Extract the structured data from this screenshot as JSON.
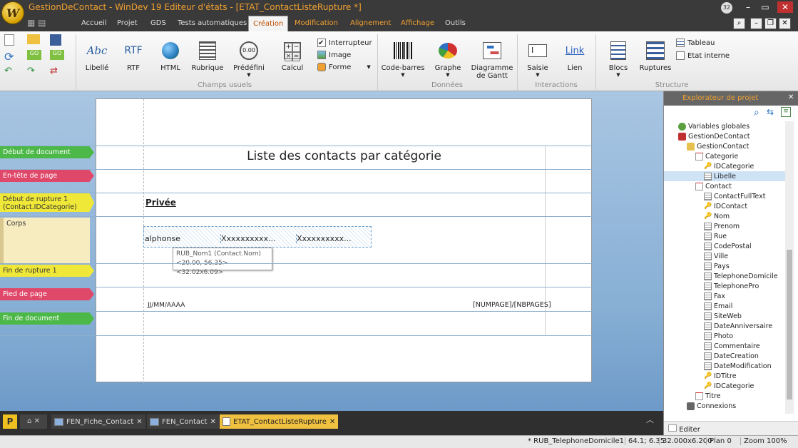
{
  "app": {
    "title": "GestionDeContact - WinDev 19  Editeur d'états - [ETAT_ContactListeRupture *]",
    "logo": "W",
    "notif_count": "32"
  },
  "menu": {
    "tabs": [
      "Accueil",
      "Projet",
      "GDS",
      "Tests automatiques",
      "Création",
      "Modification",
      "Alignement",
      "Affichage",
      "Outils"
    ]
  },
  "ribbon": {
    "champs": [
      {
        "label": "Libellé",
        "icon": "Abc"
      },
      {
        "label": "RTF",
        "icon": "RTF"
      },
      {
        "label": "HTML",
        "icon": "html-globe-icon"
      },
      {
        "label": "Rubrique",
        "icon": "rubrique-icon"
      },
      {
        "label": "Prédéfini",
        "icon": "predefini-icon"
      },
      {
        "label": "Calcul",
        "icon": "calc-icon"
      }
    ],
    "champs_small": [
      "Interrupteur",
      "Image",
      "Forme"
    ],
    "donnees": [
      {
        "label": "Code-barres"
      },
      {
        "label": "Graphe"
      },
      {
        "label": "Diagramme de Gantt"
      }
    ],
    "interactions": [
      {
        "label": "Saisie"
      },
      {
        "label": "Lien",
        "icon": "Link"
      }
    ],
    "structure": [
      {
        "label": "Blocs"
      },
      {
        "label": "Ruptures"
      }
    ],
    "structure_small": [
      "Tableau",
      "Etat interne"
    ],
    "groups": [
      "Champs usuels",
      "Données",
      "Interactions",
      "Structure"
    ]
  },
  "report": {
    "bands": [
      {
        "label": "Début de document",
        "color": "#4cb848"
      },
      {
        "label": "En-tête de page",
        "color": "#e0486a"
      },
      {
        "label": "Début de rupture 1",
        "label2": "(Contact.IDCategorie)",
        "color": "#f0e838"
      },
      {
        "label": "Corps",
        "color": "#f7ecc0"
      },
      {
        "label": "Fin de rupture 1",
        "color": "#f0e838"
      },
      {
        "label": "Pied de page",
        "color": "#e0486a"
      },
      {
        "label": "Fin de document",
        "color": "#4cb848"
      }
    ],
    "title": "Liste des contacts par catégorie",
    "rupture_text": "Privée",
    "body_fields": [
      "alphonse",
      "Xxxxxxxxxx...",
      "Xxxxxxxxxx..."
    ],
    "tooltip": {
      "line1": "RUB_Nom1 (Contact.Nom)",
      "line2": "<20.00, 56.35> <32.02x6.09>"
    },
    "date_field": "JJ/MM/AAAA",
    "pages_field": "[NUMPAGE]/[NBPAGES]"
  },
  "explorer": {
    "title": "Explorateur de projet",
    "items": [
      {
        "label": "Variables globales",
        "level": 1,
        "icon": "globe"
      },
      {
        "label": "GestionDeContact",
        "level": 1,
        "icon": "db"
      },
      {
        "label": "GestionContact",
        "level": 2,
        "icon": "folder"
      },
      {
        "label": "Categorie",
        "level": 3,
        "icon": "table"
      },
      {
        "label": "IDCategorie",
        "level": 4,
        "icon": "key"
      },
      {
        "label": "Libelle",
        "level": 4,
        "icon": "field",
        "selected": true
      },
      {
        "label": "Contact",
        "level": 3,
        "icon": "table"
      },
      {
        "label": "ContactFullText",
        "level": 4,
        "icon": "field"
      },
      {
        "label": "IDContact",
        "level": 4,
        "icon": "key"
      },
      {
        "label": "Nom",
        "level": 4,
        "icon": "key"
      },
      {
        "label": "Prenom",
        "level": 4,
        "icon": "field"
      },
      {
        "label": "Rue",
        "level": 4,
        "icon": "field"
      },
      {
        "label": "CodePostal",
        "level": 4,
        "icon": "field"
      },
      {
        "label": "Ville",
        "level": 4,
        "icon": "field"
      },
      {
        "label": "Pays",
        "level": 4,
        "icon": "field"
      },
      {
        "label": "TelephoneDomicile",
        "level": 4,
        "icon": "field"
      },
      {
        "label": "TelephonePro",
        "level": 4,
        "icon": "field"
      },
      {
        "label": "Fax",
        "level": 4,
        "icon": "field"
      },
      {
        "label": "Email",
        "level": 4,
        "icon": "field"
      },
      {
        "label": "SiteWeb",
        "level": 4,
        "icon": "field"
      },
      {
        "label": "DateAnniversaire",
        "level": 4,
        "icon": "field"
      },
      {
        "label": "Photo",
        "level": 4,
        "icon": "field"
      },
      {
        "label": "Commentaire",
        "level": 4,
        "icon": "field"
      },
      {
        "label": "DateCreation",
        "level": 4,
        "icon": "field"
      },
      {
        "label": "DateModification",
        "level": 4,
        "icon": "field"
      },
      {
        "label": "IDTitre",
        "level": 4,
        "icon": "key"
      },
      {
        "label": "IDCategorie",
        "level": 4,
        "icon": "key"
      },
      {
        "label": "Titre",
        "level": 3,
        "icon": "table"
      },
      {
        "label": "Connexions",
        "level": 2,
        "icon": "conn"
      }
    ],
    "footer_tab": "Editer"
  },
  "doctabs": [
    "FEN_Fiche_Contact",
    "FEN_Contact",
    "ETAT_ContactListeRupture"
  ],
  "status": {
    "field": "* RUB_TelephoneDomicile1",
    "pos": "64.1; 6.35",
    "size": "32.000x6.200",
    "plan": "Plan 0",
    "zoom": "Zoom 100%"
  }
}
